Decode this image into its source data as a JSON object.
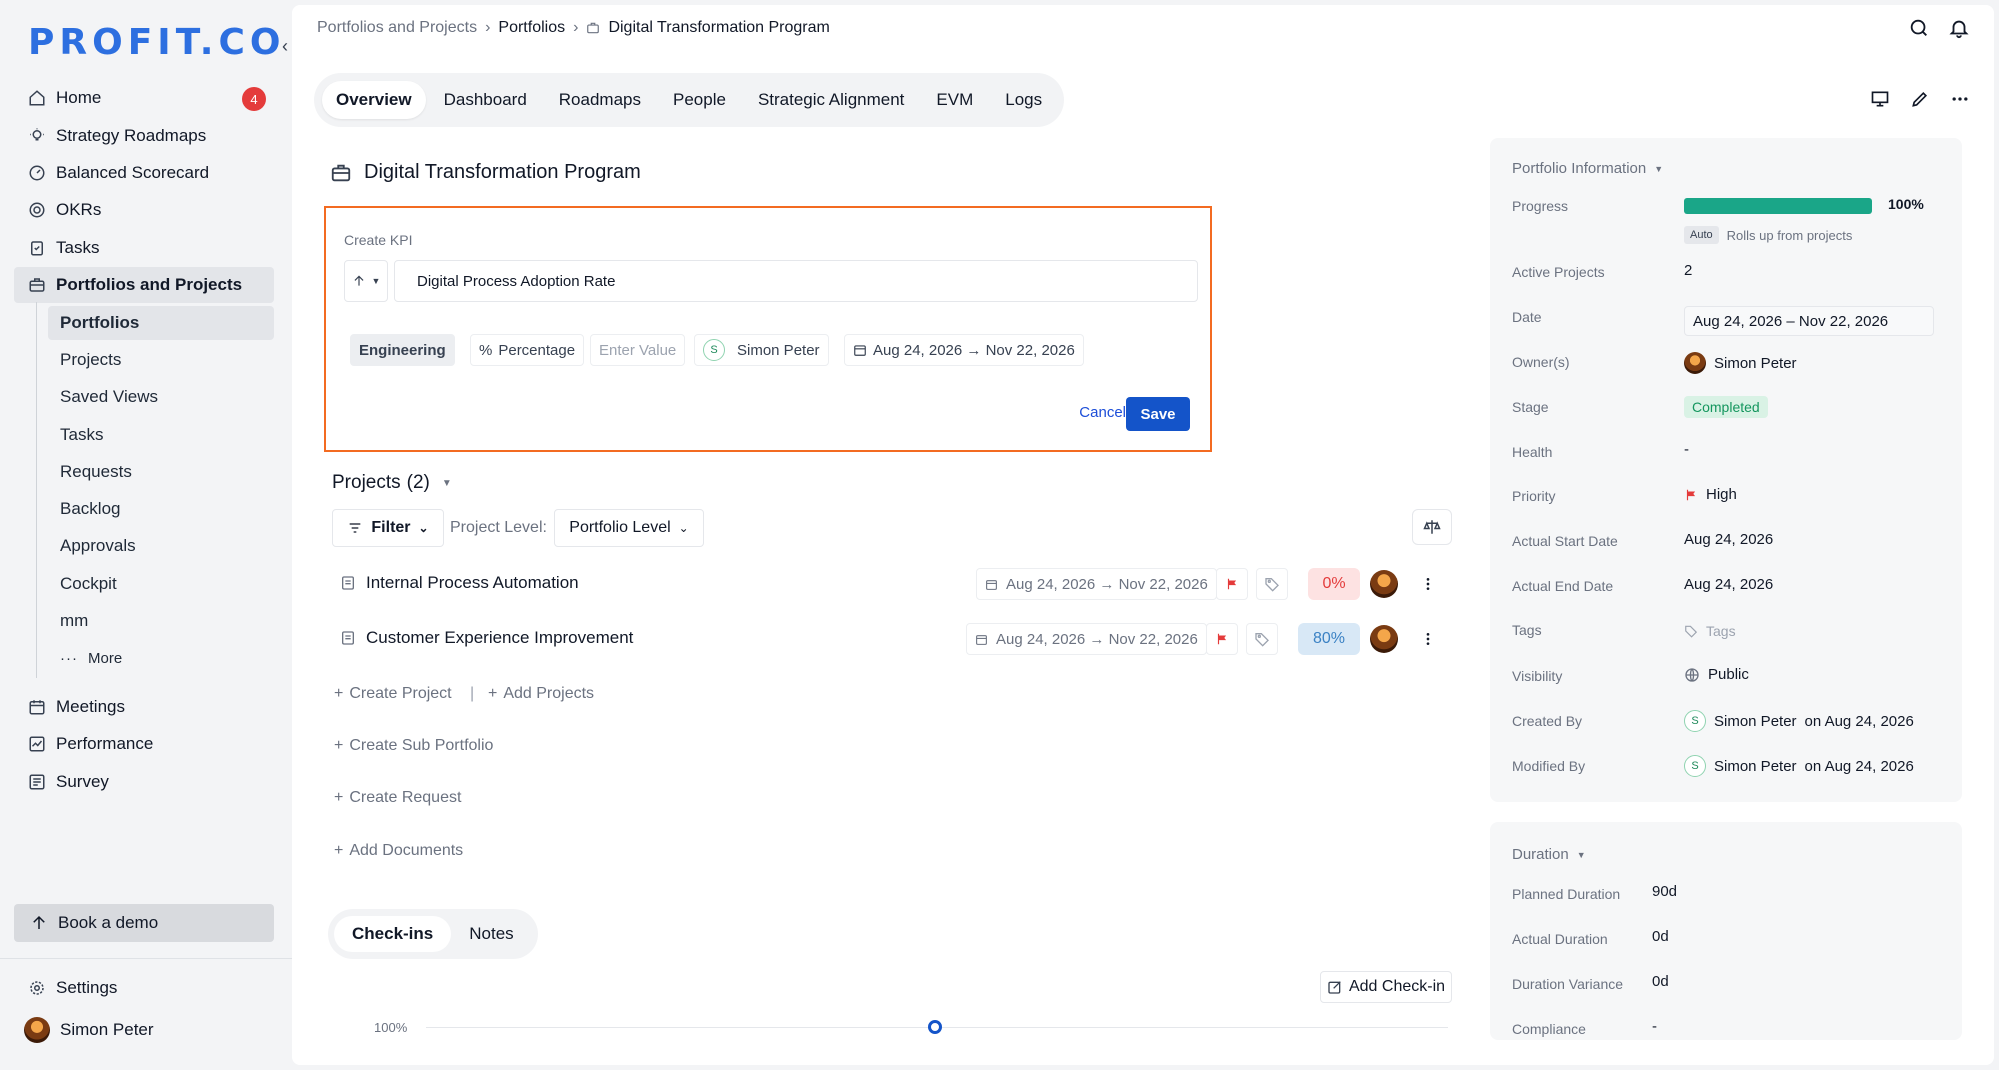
{
  "sidebar": {
    "logo": "PROFIT.CO",
    "nav": [
      {
        "label": "Home",
        "badge": "4"
      },
      {
        "label": "Strategy Roadmaps"
      },
      {
        "label": "Balanced Scorecard"
      },
      {
        "label": "OKRs"
      },
      {
        "label": "Tasks"
      },
      {
        "label": "Portfolios and Projects"
      }
    ],
    "sub": [
      "Portfolios",
      "Projects",
      "Saved Views",
      "Tasks",
      "Requests",
      "Backlog",
      "Approvals",
      "Cockpit",
      "mm",
      "More"
    ],
    "nav2": [
      "Meetings",
      "Performance",
      "Survey"
    ],
    "demo": "Book a demo",
    "settings": "Settings",
    "user": "Simon Peter"
  },
  "breadcrumb": [
    "Portfolios and Projects",
    "Portfolios",
    "Digital Transformation Program"
  ],
  "tabs": [
    "Overview",
    "Dashboard",
    "Roadmaps",
    "People",
    "Strategic Alignment",
    "EVM",
    "Logs"
  ],
  "page_title": "Digital Transformation Program",
  "kpi": {
    "label": "Create KPI",
    "name": "Digital Process Adoption Rate",
    "department": "Engineering",
    "unit": "Percentage",
    "value_placeholder": "Enter Value",
    "owner": "Simon Peter",
    "owner_initial": "S",
    "dates": "Aug 24, 2026 → Nov 22, 2026",
    "cancel": "Cancel",
    "save": "Save"
  },
  "projects": {
    "title": "Projects",
    "count": "(2)",
    "filter": "Filter",
    "level_label": "Project Level:",
    "level_value": "Portfolio Level",
    "rows": [
      {
        "name": "Internal Process Automation",
        "dates": "Aug 24, 2026 → Nov 22, 2026",
        "progress": "0%"
      },
      {
        "name": "Customer Experience Improvement",
        "dates": "Aug 24, 2026 → Nov 22, 2026",
        "progress": "80%"
      }
    ],
    "links": [
      "Create Project",
      "Add Projects",
      "Create Sub Portfolio",
      "Create Request",
      "Add Documents"
    ]
  },
  "bottom_tabs": [
    "Check-ins",
    "Notes"
  ],
  "add_checkin": "Add Check-in",
  "chart_axis": "100%",
  "portfolio_info": {
    "title": "Portfolio Information",
    "progress_label": "Progress",
    "progress_value": "100%",
    "progress_fraction": 1.0,
    "auto": "Auto",
    "rolls": "Rolls up from projects",
    "fields": [
      {
        "label": "Active Projects",
        "value": "2"
      },
      {
        "label": "Date",
        "value": "Aug 24, 2026 – Nov 22, 2026"
      },
      {
        "label": "Owner(s)",
        "value": "Simon Peter"
      },
      {
        "label": "Stage",
        "value": "Completed"
      },
      {
        "label": "Health",
        "value": "-"
      },
      {
        "label": "Priority",
        "value": "High"
      },
      {
        "label": "Actual Start Date",
        "value": "Aug 24, 2026"
      },
      {
        "label": "Actual End Date",
        "value": "Aug 24, 2026"
      },
      {
        "label": "Tags",
        "value": "Tags"
      },
      {
        "label": "Visibility",
        "value": "Public"
      },
      {
        "label": "Created By",
        "value": "Simon Peter",
        "on": "on Aug 24, 2026"
      },
      {
        "label": "Modified By",
        "value": "Simon Peter",
        "on": "on Aug 24, 2026"
      }
    ]
  },
  "duration": {
    "title": "Duration",
    "fields": [
      {
        "label": "Planned Duration",
        "value": "90d"
      },
      {
        "label": "Actual Duration",
        "value": "0d"
      },
      {
        "label": "Duration Variance",
        "value": "0d"
      },
      {
        "label": "Compliance",
        "value": "-"
      }
    ]
  },
  "colors": {
    "accent": "#1454c9",
    "highlight": "#f36b21",
    "success": "#1aa688",
    "danger": "#e43b3b"
  }
}
